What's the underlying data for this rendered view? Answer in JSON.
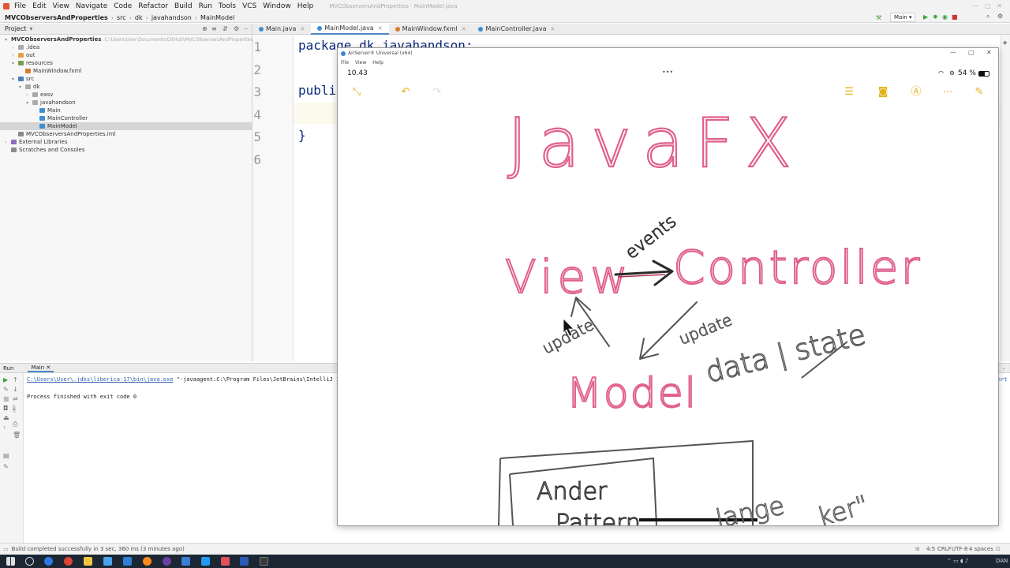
{
  "ide": {
    "menu": [
      "File",
      "Edit",
      "View",
      "Navigate",
      "Code",
      "Refactor",
      "Build",
      "Run",
      "Tools",
      "VCS",
      "Window",
      "Help"
    ],
    "window_title": "MVCObserversAndProperties - MainModel.java",
    "breadcrumb": [
      "MVCObserversAndProperties",
      "src",
      "dk",
      "javahandson",
      "MainModel"
    ],
    "run_config": "Main",
    "project_label": "Project",
    "editor_tabs": [
      "Main.java",
      "MainModel.java",
      "MainWindow.fxml",
      "MainController.java"
    ],
    "active_tab_index": 1,
    "tree": [
      {
        "label": "MVCObserversAndProperties",
        "hint": "C:\\Users\\User\\Documents\\GitHub\\MVCObserversAndProperties",
        "indent": 0,
        "color": "#4a7fbf"
      },
      {
        "label": ".idea",
        "indent": 1,
        "color": "#a9a9a9"
      },
      {
        "label": "out",
        "indent": 1,
        "color": "#e0a33c"
      },
      {
        "label": "resources",
        "indent": 1,
        "color": "#7b9c4f"
      },
      {
        "label": "MainWindow.fxml",
        "indent": 2,
        "color": "#d57b2c"
      },
      {
        "label": "src",
        "indent": 1,
        "color": "#4a7fbf"
      },
      {
        "label": "dk",
        "indent": 2,
        "color": "#a9a9a9"
      },
      {
        "label": "easv",
        "indent": 3,
        "color": "#a9a9a9"
      },
      {
        "label": "javahandson",
        "indent": 3,
        "color": "#a9a9a9"
      },
      {
        "label": "Main",
        "indent": 4,
        "color": "#3f8fcf"
      },
      {
        "label": "MainController",
        "indent": 4,
        "color": "#3f8fcf"
      },
      {
        "label": "MainModel",
        "indent": 4,
        "color": "#3f8fcf",
        "selected": true
      },
      {
        "label": "MVCObserversAndProperties.iml",
        "indent": 1,
        "color": "#8a8a8a"
      },
      {
        "label": "External Libraries",
        "indent": 0,
        "color": "#8a6fbf"
      },
      {
        "label": "Scratches and Consoles",
        "indent": 0,
        "color": "#8a8a8a"
      }
    ],
    "line_numbers": [
      "1",
      "2",
      "3",
      "4",
      "5",
      "6"
    ],
    "code_lines": [
      "package dk.javahandson;",
      "",
      "publi",
      "",
      "}",
      ""
    ],
    "run": {
      "tab_label": "Run",
      "config_tab": "Main",
      "command_path": "C:\\Users\\User\\.jdks\\liberica-17\\bin\\java.exe",
      "command_args": "\"-javaagent:C:\\Program Files\\JetBrains\\IntelliJ IDEA",
      "truncated_tail": "ert",
      "output": "Process finished with exit code 0"
    },
    "status": {
      "message": "Build completed successfully in 3 sec, 360 ms (3 minutes ago)",
      "position": "4:5",
      "line_sep": "CRLF",
      "encoding": "UTF-8",
      "indent": "4 spaces"
    }
  },
  "airserver": {
    "title": "AirServer® Universal (x64)",
    "menu": [
      "File",
      "View",
      "Help"
    ],
    "ipad_time": "10.43",
    "battery": "54 %",
    "dots": "•••",
    "drawing": {
      "title": "JavaFX",
      "view": "View",
      "controller": "Controller",
      "events": "events",
      "update_left": "update",
      "update_right": "update",
      "data_state": "data | state",
      "model": "Model",
      "box_text_1": "Ander",
      "box_text_2": "Pattern",
      "partial_right_1": "lange",
      "partial_right_2": "ker\""
    },
    "ink_colors": {
      "pink": "#e0608f",
      "gray": "#6f6f6f",
      "dark": "#2a2a2a"
    }
  },
  "taskbar": {
    "time": "DAN",
    "apps": [
      "start",
      "search",
      "chrome",
      "chrome-2",
      "file-explorer",
      "store",
      "firefox",
      "obs",
      "intellij",
      "vscode",
      "intellij-2",
      "terminal",
      "airserver"
    ]
  }
}
